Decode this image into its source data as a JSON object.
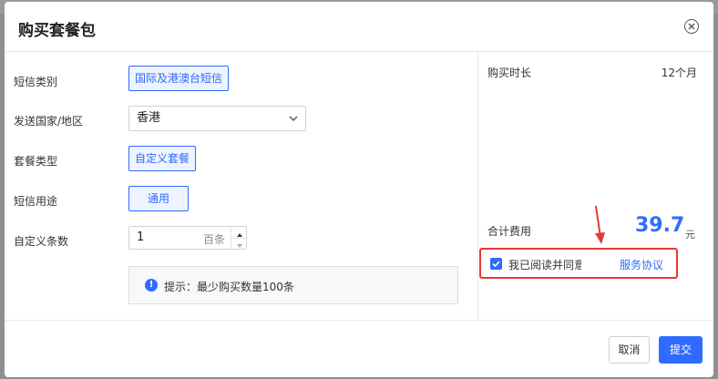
{
  "dialog": {
    "title": "购买套餐包"
  },
  "form": {
    "sms_category": {
      "label": "短信类别",
      "value": "国际及港澳台短信"
    },
    "country": {
      "label": "发送国家/地区",
      "value": "香港"
    },
    "package_type": {
      "label": "套餐类型",
      "value": "自定义套餐"
    },
    "sms_purpose": {
      "label": "短信用途",
      "value": "通用"
    },
    "custom_count": {
      "label": "自定义条数",
      "value": "1",
      "unit": "百条"
    },
    "tip": "提示：最少购买数量100条"
  },
  "summary": {
    "duration_label": "购买时长",
    "duration_value": "12个月",
    "total_label": "合计费用",
    "total_value": "39.7",
    "total_unit": "元",
    "agreement_text": "我已阅读并同意",
    "agreement_link": "服务协议",
    "agreement_checked": true
  },
  "footer": {
    "cancel_label": "取消",
    "submit_label": "提交"
  },
  "colors": {
    "accent": "#2f6bff",
    "highlight": "#e53935"
  },
  "icons": {
    "close": "close-circle-icon",
    "dropdown": "chevron-down-icon",
    "info": "info-icon",
    "checkbox": "check-icon",
    "annotation": "red-arrow-icon"
  }
}
